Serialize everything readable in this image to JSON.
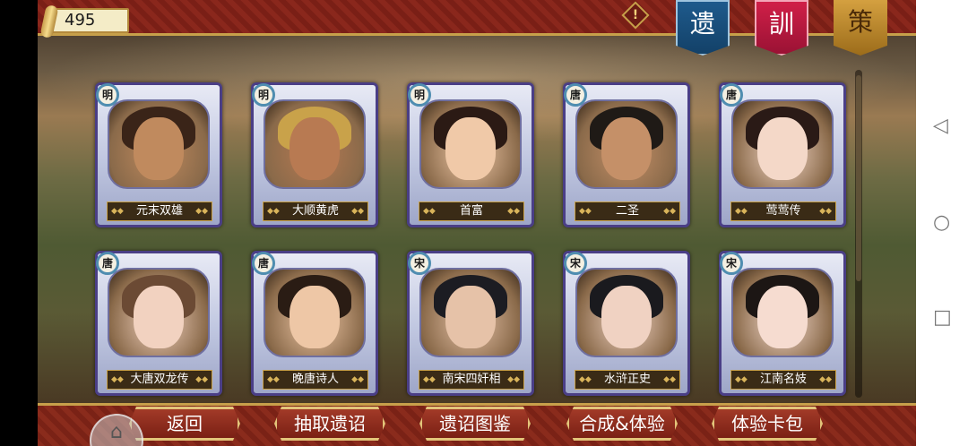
{
  "currency": {
    "amount": "495"
  },
  "tabs": [
    {
      "label": "遗",
      "color": "#1e5a8c"
    },
    {
      "label": "訓",
      "color": "#d01f48"
    },
    {
      "label": "策",
      "color": "#d4a040"
    }
  ],
  "cards": [
    {
      "dynasty": "明",
      "name": "元末双雄",
      "skin": "#c08a5e",
      "hair": "#3a2418"
    },
    {
      "dynasty": "明",
      "name": "大顺黄虎",
      "skin": "#b87a52",
      "hair": "#c9a24a"
    },
    {
      "dynasty": "明",
      "name": "首富",
      "skin": "#f0c9a8",
      "hair": "#2b1a14"
    },
    {
      "dynasty": "唐",
      "name": "二圣",
      "skin": "#c59068",
      "hair": "#1f1a16"
    },
    {
      "dynasty": "唐",
      "name": "莺莺传",
      "skin": "#f4d8c8",
      "hair": "#2a1a16"
    },
    {
      "dynasty": "唐",
      "name": "大唐双龙传",
      "skin": "#f2d2c0",
      "hair": "#6b4a34"
    },
    {
      "dynasty": "唐",
      "name": "晚唐诗人",
      "skin": "#eec7a6",
      "hair": "#2a1c14"
    },
    {
      "dynasty": "宋",
      "name": "南宋四奸相",
      "skin": "#e6c2a8",
      "hair": "#1c1c22"
    },
    {
      "dynasty": "宋",
      "name": "水浒正史",
      "skin": "#f0d2c2",
      "hair": "#1a1a1e"
    },
    {
      "dynasty": "宋",
      "name": "江南名妓",
      "skin": "#f6dcd0",
      "hair": "#1c1614"
    }
  ],
  "buttons": {
    "back": "返回",
    "draw": "抽取遗诏",
    "catalog": "遗诏图鉴",
    "combine": "合成&体验",
    "trial": "体验卡包"
  },
  "icons": {
    "info": "!",
    "home": "⌂",
    "nav_back": "◁",
    "nav_home": "○",
    "nav_recent": "□"
  }
}
